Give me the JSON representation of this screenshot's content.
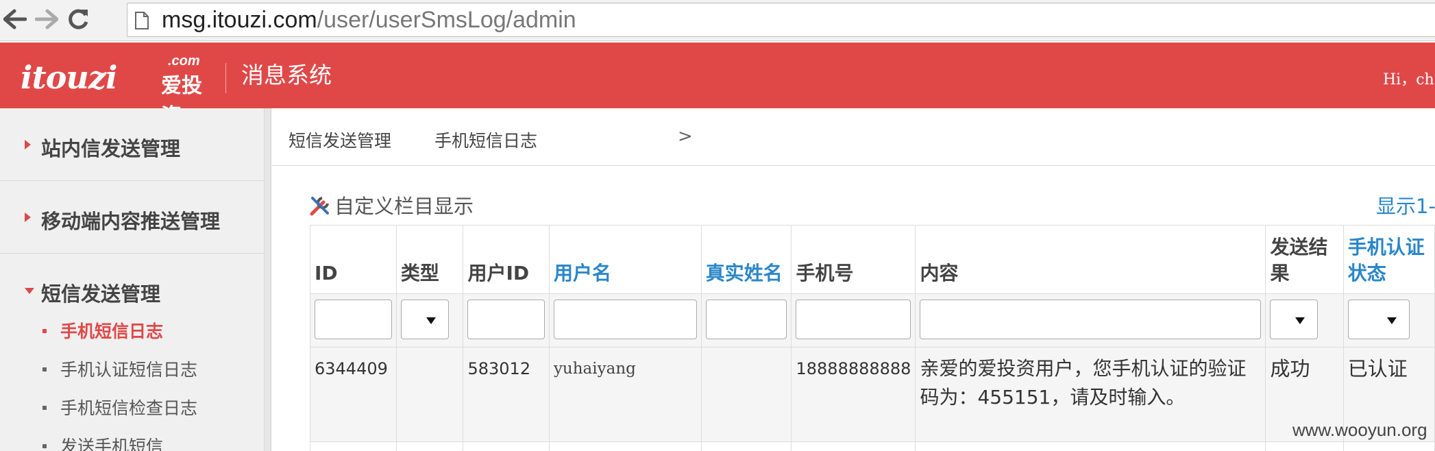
{
  "browser": {
    "url_host": "msg.itouzi.com",
    "url_path": "/user/userSmsLog/admin"
  },
  "header": {
    "logo_main": "itouzi",
    "logo_com": ".com",
    "logo_cn": "爱投资",
    "system_title": "消息系统",
    "greeting": "Hi，ch",
    "brand_color": "#e04848"
  },
  "sidebar": {
    "sections": [
      {
        "label": "站内信发送管理",
        "expanded": false
      },
      {
        "label": "移动端内容推送管理",
        "expanded": false
      },
      {
        "label": "短信发送管理",
        "expanded": true
      }
    ],
    "sub_items": [
      {
        "label": "手机短信日志",
        "active": true
      },
      {
        "label": "手机认证短信日志",
        "active": false
      },
      {
        "label": "手机短信检查日志",
        "active": false
      },
      {
        "label": "发送手机短信",
        "active": false
      }
    ]
  },
  "breadcrumb": {
    "parent": "短信发送管理",
    "separator": ">",
    "current": "手机短信日志"
  },
  "toolbar": {
    "custom_columns": "自定义栏目显示",
    "showing": "显示1-"
  },
  "table": {
    "columns": [
      {
        "label": "ID",
        "sortable": false
      },
      {
        "label": "类型",
        "sortable": false
      },
      {
        "label": "用户ID",
        "sortable": false
      },
      {
        "label": "用户名",
        "sortable": true
      },
      {
        "label": "真实姓名",
        "sortable": true
      },
      {
        "label": "手机号",
        "sortable": false
      },
      {
        "label": "内容",
        "sortable": false
      },
      {
        "label": "发送结果",
        "sortable": false
      },
      {
        "label": "手机认证状态",
        "sortable": true
      }
    ],
    "rows": [
      {
        "id": "6344409",
        "type": "",
        "user_id": "583012",
        "username": "yuhaiyang",
        "real_name": "",
        "phone": "18888888888",
        "content": "亲爱的爱投资用户，您手机认证的验证码为：455151，请及时输入。",
        "result": "成功",
        "verify_status": "已认证"
      }
    ]
  },
  "watermark": "www.wooyun.org"
}
